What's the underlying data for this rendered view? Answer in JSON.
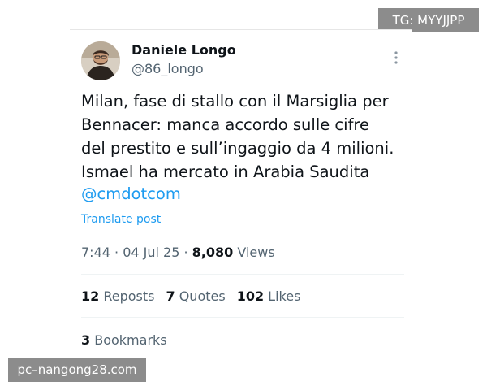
{
  "watermarks": {
    "top_right": "TG: MYYJJPP",
    "bottom_left": "pc–nangong28.com"
  },
  "author": {
    "name": "Daniele Longo",
    "handle": "@86_longo",
    "avatar_icon": "person-avatar"
  },
  "more_icon": "three-dots-vertical-icon",
  "tweet": {
    "lines": [
      "Milan, fase di stallo con il Marsiglia per",
      "Bennacer: manca accordo sulle cifre",
      "del prestito e sull’ingaggio da 4 milioni.",
      "Ismael ha mercato in Arabia Saudita"
    ],
    "mention": "@cmdotcom"
  },
  "translate_label": "Translate post",
  "meta": {
    "time": "7:44",
    "separator": " · ",
    "date": "04 Jul 25",
    "views_count": "8,080",
    "views_label": " Views"
  },
  "stats": {
    "reposts_count": "12",
    "reposts_label": " Reposts",
    "quotes_count": "7",
    "quotes_label": " Quotes",
    "likes_count": "102",
    "likes_label": " Likes",
    "bookmarks_count": "3",
    "bookmarks_label": " Bookmarks"
  },
  "colors": {
    "link": "#1d9bf0",
    "text": "#0f1419",
    "secondary": "#536471"
  }
}
